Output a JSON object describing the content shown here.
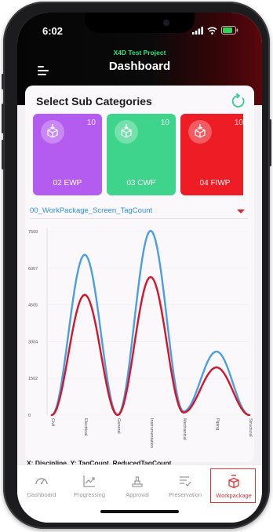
{
  "status": {
    "time": "6:02"
  },
  "header": {
    "project": "X4D Test Project",
    "title": "Dashboard"
  },
  "card": {
    "title": "Select Sub Categories"
  },
  "tiles": [
    {
      "label": "02 EWP",
      "count": "10",
      "color": "#b45cf0"
    },
    {
      "label": "03 CWP",
      "count": "10",
      "color": "#3fd48c"
    },
    {
      "label": "04 FIWP",
      "count": "10",
      "color": "#ee1c24"
    }
  ],
  "selector": {
    "value": "00_WorkPackage_Screen_TagCount"
  },
  "chart_data": {
    "type": "line",
    "categories": [
      "Civil",
      "Electrical",
      "General",
      "Instrumentation",
      "Mechanical",
      "Piping",
      "Structural"
    ],
    "yticks": [
      "0",
      "1502",
      "3004",
      "4505",
      "6007",
      "7509"
    ],
    "ylim": [
      0,
      7509
    ],
    "series": [
      {
        "values": [
          0,
          6560,
          0,
          7540,
          150,
          2600,
          0
        ],
        "color": "#4a9fe0"
      },
      {
        "values": [
          0,
          4920,
          0,
          5650,
          100,
          1950,
          0
        ],
        "color": "#d4142a"
      }
    ],
    "footer": "X: Discipline, Y: TagCount, ReducedTagCount"
  },
  "tabs": [
    {
      "label": "Dashboard",
      "icon": "gauge-icon",
      "active": false
    },
    {
      "label": "Progressing",
      "icon": "trend-chart-icon",
      "active": false
    },
    {
      "label": "Approval",
      "icon": "approval-icon",
      "active": false
    },
    {
      "label": "Preservation",
      "icon": "checklist-icon",
      "active": false
    },
    {
      "label": "Workpackage",
      "icon": "package-icon",
      "active": true
    }
  ]
}
